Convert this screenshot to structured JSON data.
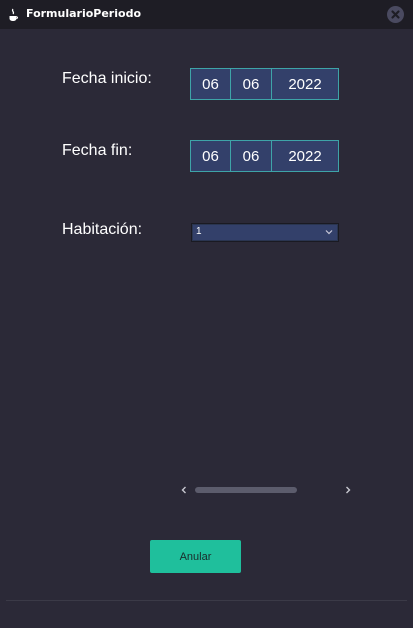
{
  "window": {
    "title": "FormularioPeriodo",
    "close_icon": "close-icon"
  },
  "form": {
    "fecha_inicio": {
      "label": "Fecha inicio:",
      "day": "06",
      "month": "06",
      "year": "2022"
    },
    "fecha_fin": {
      "label": "Fecha fin:",
      "day": "06",
      "month": "06",
      "year": "2022"
    },
    "habitacion": {
      "label": "Habitación:",
      "selected": "1"
    }
  },
  "actions": {
    "anular_label": "Anular"
  },
  "colors": {
    "background": "#2b2937",
    "titlebar": "#1e1d25",
    "field": "#33406a",
    "field_border": "#3ea4a8",
    "accent_button": "#1fbf9c"
  }
}
